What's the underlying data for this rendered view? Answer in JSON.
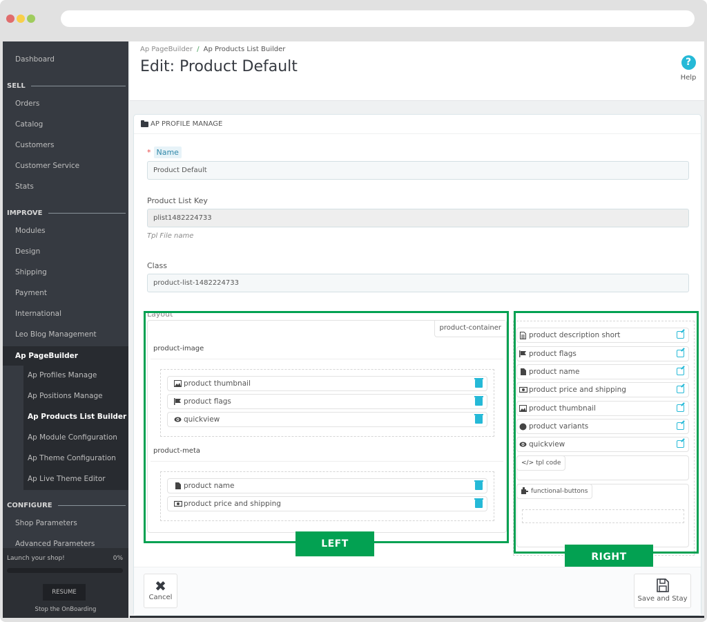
{
  "browser": {
    "traffic_lights": [
      "#e06c6c",
      "#f8cf4a",
      "#9fcc5d"
    ]
  },
  "sidebar": {
    "dashboard": "Dashboard",
    "sections": [
      {
        "label": "SELL",
        "items": [
          "Orders",
          "Catalog",
          "Customers",
          "Customer Service",
          "Stats"
        ]
      },
      {
        "label": "IMPROVE",
        "items": [
          "Modules",
          "Design",
          "Shipping",
          "Payment",
          "International",
          "Leo Blog Management"
        ]
      },
      {
        "label": "CONFIGURE",
        "items": [
          "Shop Parameters",
          "Advanced Parameters"
        ]
      }
    ],
    "active": "Ap PageBuilder",
    "submenu": [
      "Ap Profiles Manage",
      "Ap Positions Manage",
      "Ap Products List Builder",
      "Ap Module Configuration",
      "Ap Theme Configuration",
      "Ap Live Theme Editor"
    ],
    "submenu_current": "Ap Products List Builder",
    "onboarding": {
      "title": "Launch your shop!",
      "percent_label": "0%",
      "progress": 0,
      "resume_label": "RESUME",
      "stop_label": "Stop the OnBoarding"
    }
  },
  "header": {
    "breadcrumb": [
      "Ap PageBuilder",
      "Ap Products List Builder"
    ],
    "breadcrumb_sep": "/",
    "title": "Edit: Product Default",
    "help_icon": "?",
    "help_label": "Help"
  },
  "panel": {
    "title": "AP PROFILE MANAGE",
    "fields": {
      "name": {
        "label": "Name",
        "required_mark": "*",
        "value": "Product Default"
      },
      "key": {
        "label": "Product List Key",
        "value": "plist1482224733",
        "hint": "Tpl File name"
      },
      "class": {
        "label": "Class",
        "value": "product-list-1482224733"
      }
    },
    "layout_label": "Layout",
    "left": {
      "container_tag": "product-container",
      "groups": [
        {
          "title": "product-image",
          "elements": [
            {
              "icon": "image-icon",
              "label": "product thumbnail"
            },
            {
              "icon": "flag-icon",
              "label": "product flags"
            },
            {
              "icon": "eye-icon",
              "label": "quickview"
            }
          ]
        },
        {
          "title": "product-meta",
          "elements": [
            {
              "icon": "file-icon",
              "label": "product name"
            },
            {
              "icon": "money-icon",
              "label": "product price and shipping"
            }
          ]
        }
      ]
    },
    "right": {
      "elements": [
        {
          "icon": "file-text-icon",
          "label": "product description short"
        },
        {
          "icon": "flag-icon",
          "label": "product flags"
        },
        {
          "icon": "file-icon",
          "label": "product name"
        },
        {
          "icon": "money-icon",
          "label": "product price and shipping"
        },
        {
          "icon": "image-icon",
          "label": "product thumbnail"
        },
        {
          "icon": "circle-icon",
          "label": "product variants"
        },
        {
          "icon": "eye-icon",
          "label": "quickview"
        }
      ],
      "tpl_code": "tpl code",
      "functional_buttons": "functional-buttons"
    },
    "annotations": {
      "left": "LEFT",
      "right": "RIGHT",
      "color": "#03a152"
    },
    "footer": {
      "cancel": "Cancel",
      "save_stay": "Save and Stay"
    }
  },
  "colors": {
    "accent": "#25b9d7",
    "sidebar_bg": "#363a41",
    "highlight_green": "#03a152"
  }
}
